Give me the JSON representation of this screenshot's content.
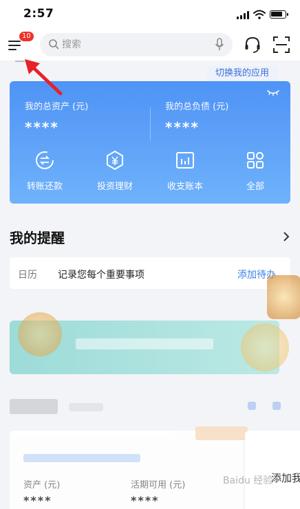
{
  "status_bar": {
    "time": "2:57"
  },
  "top_bar": {
    "notification_count": "10",
    "search_placeholder": "搜索"
  },
  "switch_apps_label": "切换我的应用",
  "asset_card": {
    "total_assets_label": "我的总资产 (元)",
    "total_assets_value": "****",
    "total_liabilities_label": "我的总负债 (元)",
    "total_liabilities_value": "****",
    "actions": [
      {
        "label": "转账还款",
        "icon": "transfer-icon"
      },
      {
        "label": "投资理财",
        "icon": "investment-icon"
      },
      {
        "label": "收支账本",
        "icon": "ledger-icon"
      },
      {
        "label": "全部",
        "icon": "all-apps-icon"
      }
    ]
  },
  "reminders": {
    "title": "我的提醒",
    "calendar_label": "日历",
    "description": "记录您每个重要事项",
    "add_todo": "添加待办"
  },
  "account_card": {
    "assets_label": "资产 (元)",
    "assets_value": "****",
    "available_label": "活期可用 (元)",
    "available_value": "****",
    "add_label": "添加我"
  },
  "watermark": "Baidu 经验",
  "colors": {
    "card_gradient_start": "#4f93f6",
    "card_gradient_end": "#6fb2fb",
    "badge": "#f0302a",
    "link": "#3a7ee8",
    "annotation_arrow": "#e8202a"
  }
}
